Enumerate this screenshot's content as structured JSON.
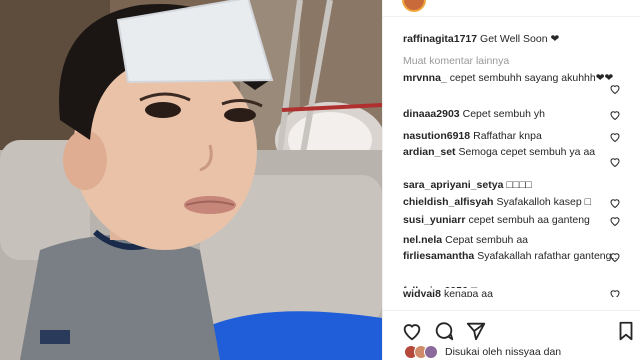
{
  "post": {
    "caption_user": "raffinagita1717",
    "caption_text": "Get Well Soon ❤",
    "more_comments": "Muat komentar lainnya"
  },
  "comments": [
    {
      "user": "mrvnna_",
      "text": "cepet sembuhh sayang akuhhh❤❤"
    },
    {
      "user": "dinaaa2903",
      "text": "Cepet sembuh yh"
    },
    {
      "user": "nasution6918",
      "text": "Raffathar knpa"
    },
    {
      "user": "ardian_set",
      "text": "Semoga cepet sembuh ya aa"
    },
    {
      "user": "sara_apriyani_setya",
      "text": "□□□□"
    },
    {
      "user": "chieldish_alfisyah",
      "text": "Syafakalloh kasep □"
    },
    {
      "user": "susi_yuniarr",
      "text": "cepet sembuh aa ganteng"
    },
    {
      "user": "nel.nela",
      "text": "Cepat sembuh aa"
    },
    {
      "user": "firliesamantha",
      "text": "Syafakallah rafathar ganteng.."
    },
    {
      "user": "fellycia_0056",
      "text": "□"
    },
    {
      "user": "widyai8",
      "text": "kenapa aa"
    }
  ],
  "likes_text": "Disukai oleh nissyaa dan",
  "icons": {
    "like": "heart-icon",
    "comment": "comment-icon",
    "share": "share-icon",
    "save": "bookmark-icon",
    "comment_like": "heart-icon"
  },
  "colors": {
    "text": "#262626",
    "muted": "#999999",
    "border": "#efefef",
    "story_ring": "#f2a63b"
  }
}
